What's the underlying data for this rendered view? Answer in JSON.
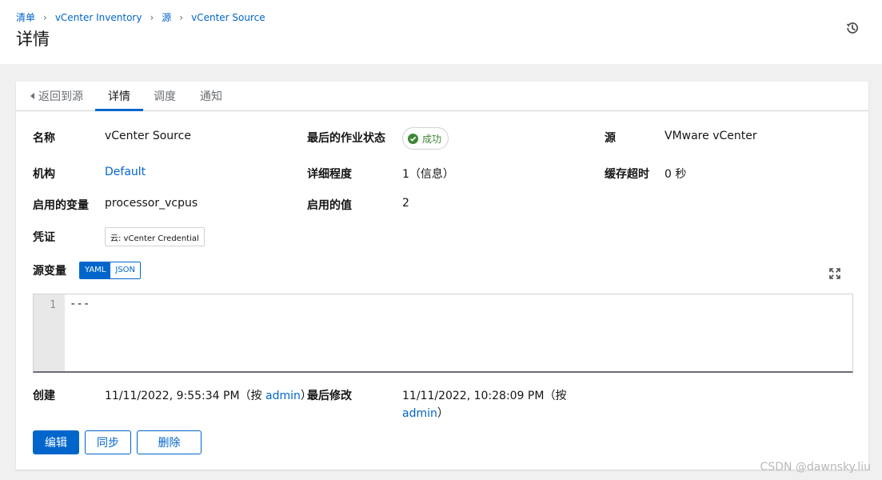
{
  "breadcrumb": {
    "items": [
      "清单",
      "vCenter Inventory",
      "源",
      "vCenter Source"
    ],
    "separator": "›"
  },
  "page": {
    "title": "详情"
  },
  "tabs": {
    "back": "返回到源",
    "details": "详情",
    "schedules": "调度",
    "notifications": "通知"
  },
  "details": {
    "name_label": "名称",
    "name_value": "vCenter Source",
    "last_job_label": "最后的作业状态",
    "last_job_value": "成功",
    "source_label": "源",
    "source_value": "VMware vCenter",
    "org_label": "机构",
    "org_value": "Default",
    "verbosity_label": "详细程度",
    "verbosity_value": "1（信息）",
    "cache_label": "缓存超时",
    "cache_value": "0 秒",
    "enabled_var_label": "启用的变量",
    "enabled_var_value": "processor_vcpus",
    "enabled_value_label": "启用的值",
    "enabled_value_value": "2",
    "credential_label": "凭证",
    "credential_value": "云: vCenter Credential",
    "source_vars_label": "源变量",
    "yaml_label": "YAML",
    "json_label": "JSON",
    "code_line_no": "1",
    "code_text": "---",
    "created_label": "创建",
    "created_prefix": "11/11/2022, 9:55:34 PM（按 ",
    "created_by": "admin",
    "created_suffix": "）",
    "modified_label": "最后修改",
    "modified_prefix": "11/11/2022, 10:28:09 PM（按",
    "modified_by": "admin",
    "modified_suffix": "）"
  },
  "buttons": {
    "edit": "编辑",
    "sync": "同步",
    "delete": "删除"
  },
  "watermark": "CSDN @dawnsky.liu",
  "colors": {
    "accent": "#0066cc",
    "success": "#3e8635",
    "text": "#151515",
    "muted": "#6a6e73"
  },
  "icons": {
    "history": "history-icon",
    "back": "caret-left-icon",
    "success": "check-circle-icon",
    "expand": "expand-icon"
  }
}
